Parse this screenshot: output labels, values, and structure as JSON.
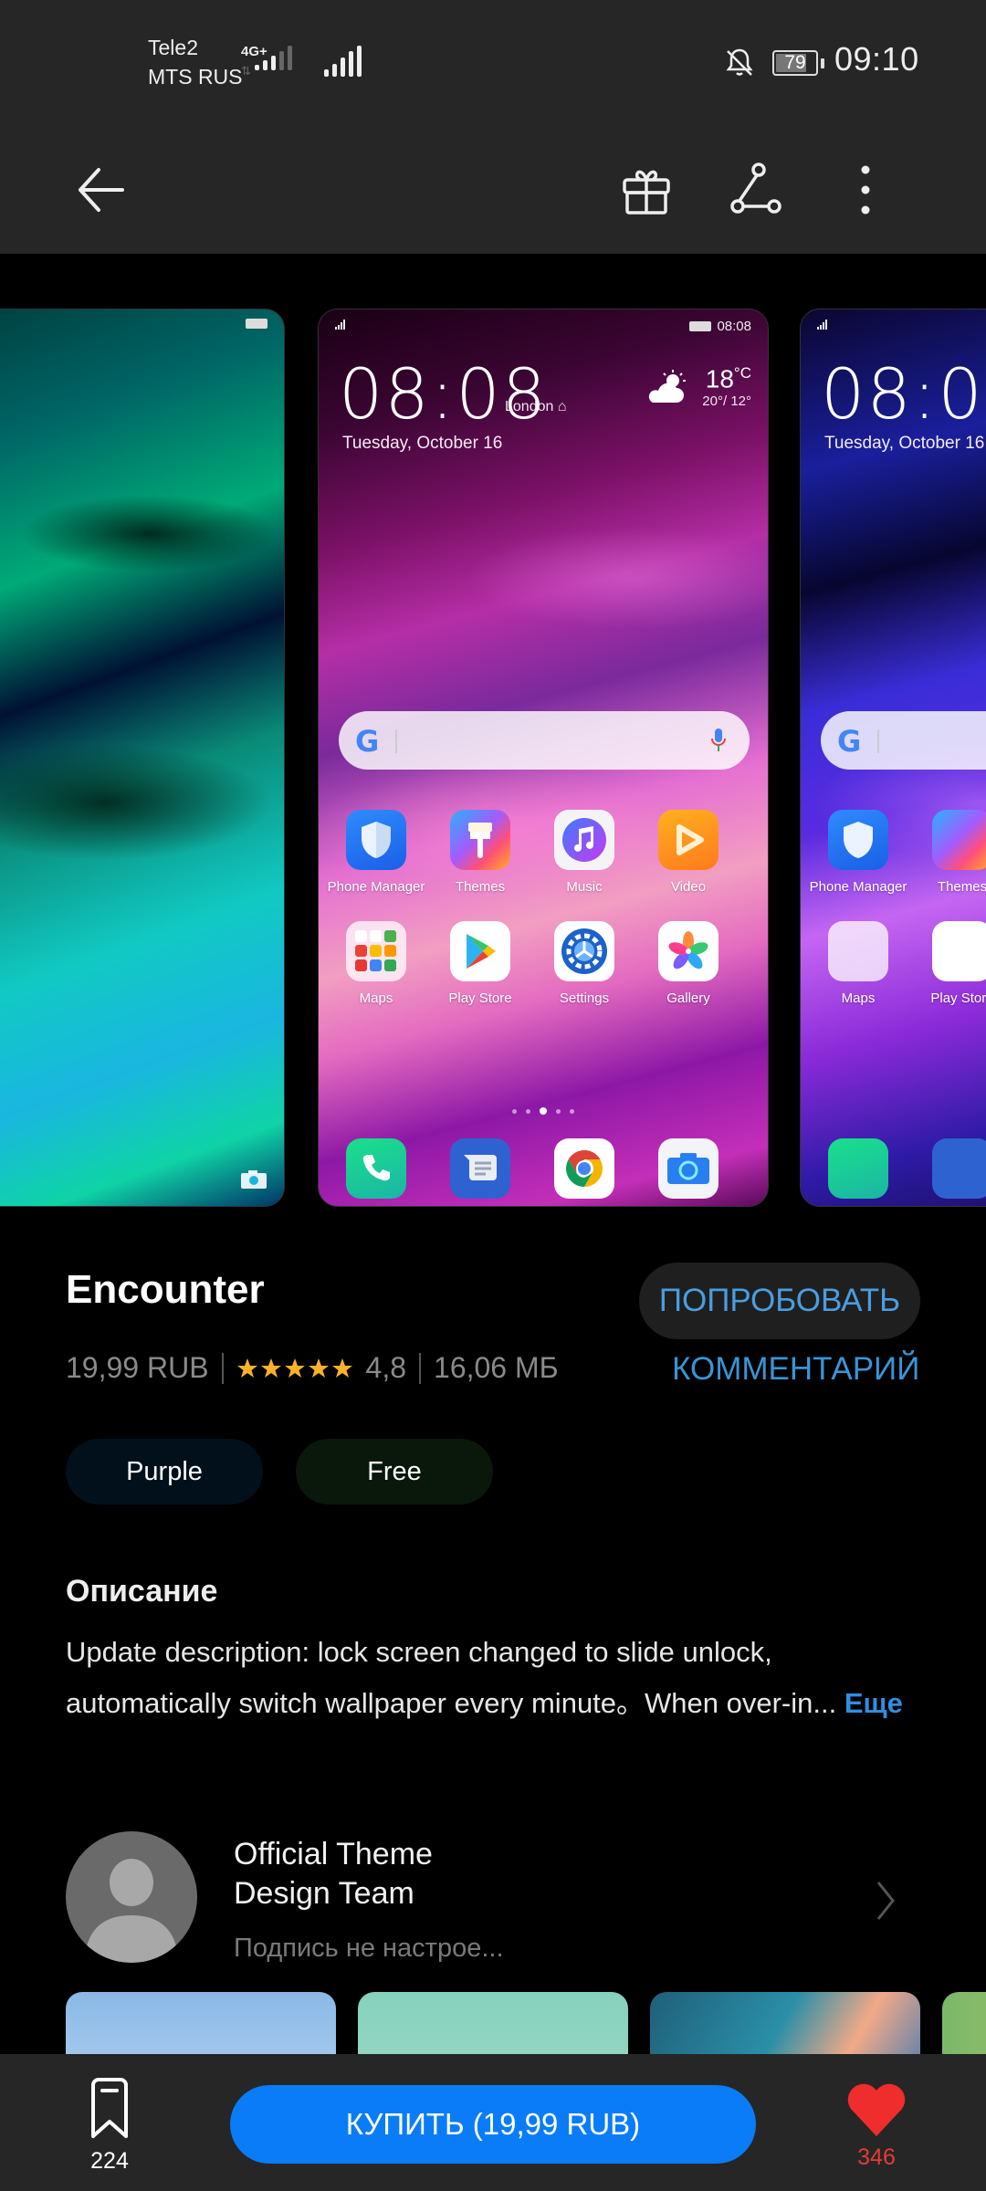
{
  "status_bar": {
    "carrier_1": "Tele2",
    "carrier_2": "MTS RUS",
    "network_type": "4G+",
    "battery_level": "79",
    "time": "09:10",
    "icons": [
      "signal-icon",
      "signal-icon",
      "silent-bell-icon",
      "battery-icon"
    ]
  },
  "toolbar": {
    "back_icon": "arrow-left-icon",
    "gift_icon": "gift-icon",
    "share_icon": "share-icon",
    "more_icon": "more-vertical-icon"
  },
  "preview": {
    "lock_time": "08:08",
    "mini_clock": "08:08",
    "city": "London",
    "date": "Tuesday, October 16",
    "temperature": "18",
    "temperature_unit": "°C",
    "high_low": "20°/ 12°",
    "partial_lock_time": "08",
    "apps_row1": [
      {
        "label": "Phone Manager",
        "icon": "shield-icon"
      },
      {
        "label": "Themes",
        "icon": "paintbrush-icon"
      },
      {
        "label": "Music",
        "icon": "music-note-icon"
      },
      {
        "label": "Video",
        "icon": "play-icon"
      }
    ],
    "apps_row2": [
      {
        "label": "Maps",
        "icon": "folder-icon"
      },
      {
        "label": "Play Store",
        "icon": "play-store-icon"
      },
      {
        "label": "Settings",
        "icon": "gear-icon"
      },
      {
        "label": "Gallery",
        "icon": "pinwheel-icon"
      }
    ],
    "dock": [
      {
        "icon": "phone-icon"
      },
      {
        "icon": "message-icon"
      },
      {
        "icon": "chrome-icon"
      },
      {
        "icon": "camera-icon"
      }
    ],
    "page_count": 5,
    "active_page": 3
  },
  "theme": {
    "title": "Encounter",
    "price": "19,99 RUB",
    "rating_value": "4,8",
    "rating_stars": 5,
    "size": "16,06 МБ",
    "try_label": "ПОПРОБОВАТЬ",
    "comment_label": "КОММЕНТАРИЙ",
    "tags": [
      "Purple",
      "Free"
    ]
  },
  "description": {
    "heading": "Описание",
    "text": "Update description: lock screen changed to slide unlock, automatically switch wallpaper every minute。When over-in... ",
    "more_label": "Еще"
  },
  "author": {
    "name_line1": "Official Theme",
    "name_line2": "Design Team",
    "signature": "Подпись не настрое..."
  },
  "bottom_bar": {
    "favorites_count": "224",
    "buy_label": "КУПИТЬ (19,99 RUB)",
    "likes_count": "346"
  },
  "colors": {
    "accent_blue": "#0a7cf8",
    "link_blue": "#3a94d6",
    "star": "#fbb12a",
    "like_red": "#e33b36"
  }
}
